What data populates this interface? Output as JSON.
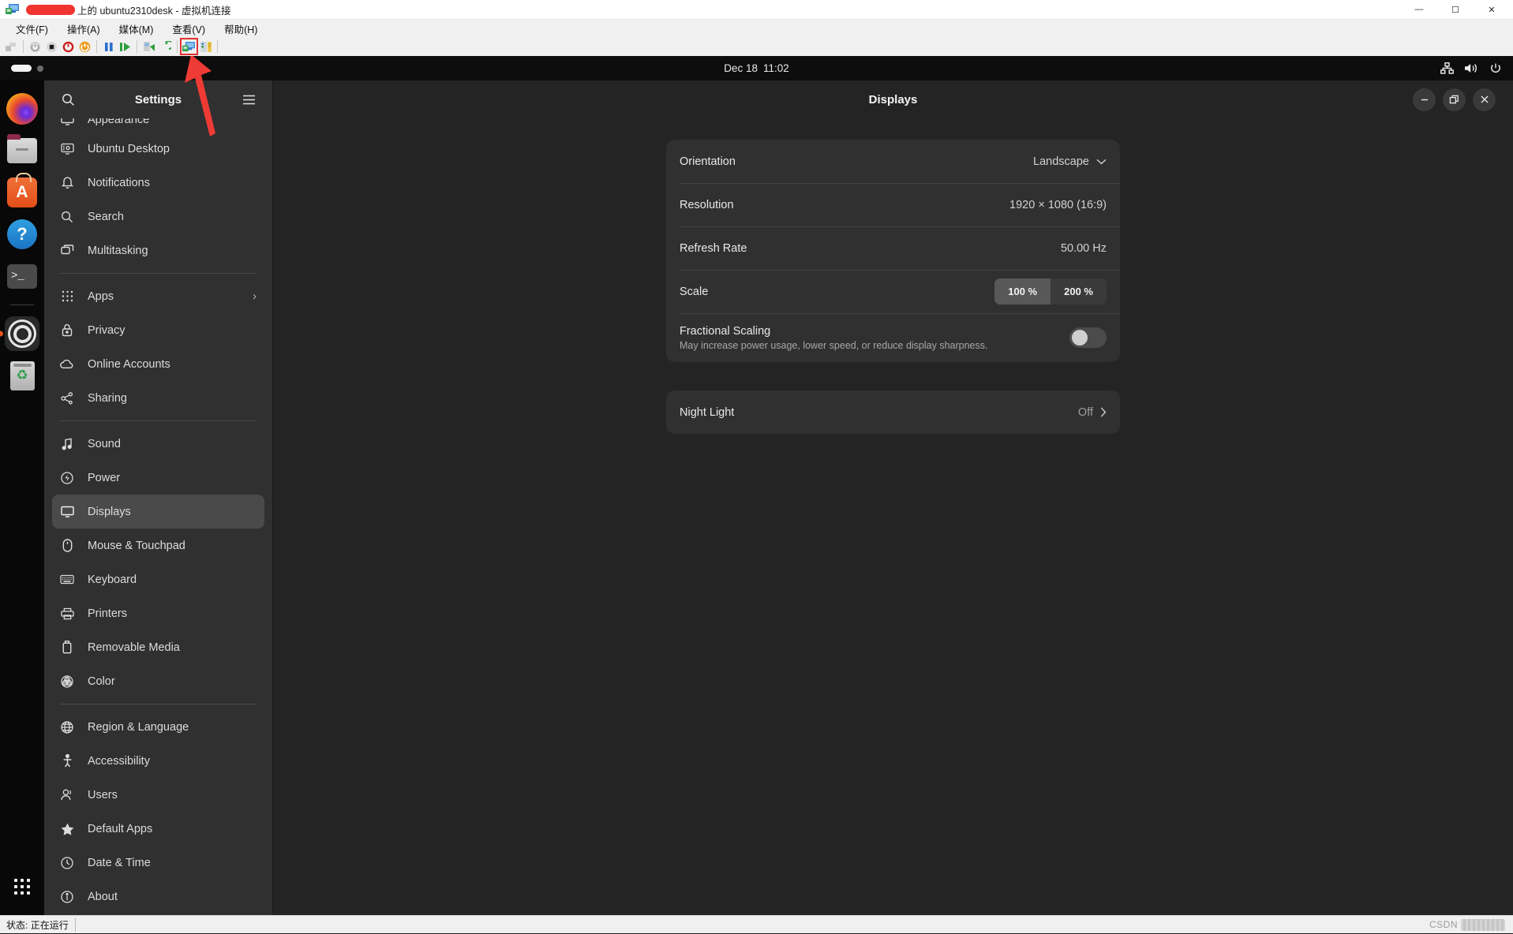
{
  "vm_window": {
    "title_prefix_redacted": true,
    "title": "上的 ubuntu2310desk - 虚拟机连接",
    "title_icon": "vm-monitor-icon",
    "controls": {
      "minimize": "—",
      "maximize": "☐",
      "close": "✕"
    },
    "menus": [
      "文件(F)",
      "操作(A)",
      "媒体(M)",
      "查看(V)",
      "帮助(H)"
    ],
    "toolbar_icons": [
      "ctrl-alt-del-icon",
      "shutdown-icon",
      "turn-off-icon",
      "power-off-icon",
      "start-icon",
      "pause-icon",
      "resume-icon",
      "checkpoint-icon",
      "revert-icon",
      "enhanced-session-icon",
      "settings-icon"
    ],
    "statusbar": {
      "status_label": "状态:",
      "status_value": "正在运行"
    },
    "watermark": "CSDN"
  },
  "topbar": {
    "clock_date": "Dec 18",
    "clock_time": "11:02",
    "tray_icons": [
      "network-wired-icon",
      "volume-icon",
      "power-icon"
    ],
    "workspace_icons": [
      "workspace-active-pill",
      "workspace-dot"
    ]
  },
  "dock": {
    "items": [
      {
        "name": "firefox",
        "icon": "firefox-icon",
        "active": false
      },
      {
        "name": "files",
        "icon": "files-icon",
        "active": false
      },
      {
        "name": "ubuntu-software",
        "icon": "ubuntu-software-icon",
        "glyph": "A",
        "active": false
      },
      {
        "name": "help",
        "icon": "help-icon",
        "glyph": "?",
        "active": false
      },
      {
        "name": "terminal",
        "icon": "terminal-icon",
        "glyph": ">_",
        "active": false
      },
      {
        "name": "settings",
        "icon": "settings-gear-icon",
        "active": true
      },
      {
        "name": "trash",
        "icon": "trash-icon",
        "glyph": "♻",
        "active": false
      }
    ],
    "show_apps": {
      "name": "show-applications",
      "icon": "app-grid-icon"
    }
  },
  "settings": {
    "sidebar": {
      "title": "Settings",
      "search_icon": "search-icon",
      "menu_icon": "hamburger-menu-icon",
      "groups": [
        {
          "items": [
            {
              "label": "Appearance",
              "icon": "appearance-icon",
              "selected": false,
              "partial": true
            },
            {
              "label": "Ubuntu Desktop",
              "icon": "ubuntu-desktop-icon",
              "selected": false
            },
            {
              "label": "Notifications",
              "icon": "bell-icon",
              "selected": false
            },
            {
              "label": "Search",
              "icon": "search-icon",
              "selected": false
            },
            {
              "label": "Multitasking",
              "icon": "windows-icon",
              "selected": false
            }
          ]
        },
        {
          "items": [
            {
              "label": "Apps",
              "icon": "grid-icon",
              "selected": false,
              "chevron": "›"
            },
            {
              "label": "Privacy",
              "icon": "lock-icon",
              "selected": false
            },
            {
              "label": "Online Accounts",
              "icon": "cloud-icon",
              "selected": false
            },
            {
              "label": "Sharing",
              "icon": "share-icon",
              "selected": false
            }
          ]
        },
        {
          "items": [
            {
              "label": "Sound",
              "icon": "music-note-icon",
              "selected": false
            },
            {
              "label": "Power",
              "icon": "power-bolt-icon",
              "selected": false
            },
            {
              "label": "Displays",
              "icon": "monitor-icon",
              "selected": true
            },
            {
              "label": "Mouse & Touchpad",
              "icon": "mouse-icon",
              "selected": false
            },
            {
              "label": "Keyboard",
              "icon": "keyboard-icon",
              "selected": false
            },
            {
              "label": "Printers",
              "icon": "printer-icon",
              "selected": false
            },
            {
              "label": "Removable Media",
              "icon": "usb-drive-icon",
              "selected": false
            },
            {
              "label": "Color",
              "icon": "color-wheel-icon",
              "selected": false
            }
          ]
        },
        {
          "items": [
            {
              "label": "Region & Language",
              "icon": "globe-icon",
              "selected": false
            },
            {
              "label": "Accessibility",
              "icon": "accessibility-icon",
              "selected": false
            },
            {
              "label": "Users",
              "icon": "users-icon",
              "selected": false
            },
            {
              "label": "Default Apps",
              "icon": "star-icon",
              "selected": false
            },
            {
              "label": "Date & Time",
              "icon": "clock-icon",
              "selected": false
            },
            {
              "label": "About",
              "icon": "info-icon",
              "selected": false
            }
          ]
        }
      ]
    },
    "main": {
      "title": "Displays",
      "window_controls": {
        "minimize": "—",
        "maximize": "restore-icon",
        "close": "✕"
      },
      "rows": {
        "orientation": {
          "label": "Orientation",
          "value": "Landscape",
          "chevron": "chevron-down-icon"
        },
        "resolution": {
          "label": "Resolution",
          "value": "1920 × 1080 (16:9)"
        },
        "refresh_rate": {
          "label": "Refresh Rate",
          "value": "50.00 Hz"
        },
        "scale": {
          "label": "Scale",
          "options": [
            "100 %",
            "200 %"
          ],
          "selected_index": 0
        },
        "fractional_scaling": {
          "label": "Fractional Scaling",
          "subtitle": "May increase power usage, lower speed, or reduce display sharpness.",
          "enabled": false
        },
        "night_light": {
          "label": "Night Light",
          "value": "Off",
          "chevron": "chevron-right-icon"
        }
      }
    }
  },
  "colors": {
    "accent": "#e95420",
    "window_bg": "#242424",
    "card_bg": "#303030",
    "sidebar_bg": "#303030",
    "selected_row": "#4a4a4a",
    "annotation_red": "#ef3b36"
  }
}
